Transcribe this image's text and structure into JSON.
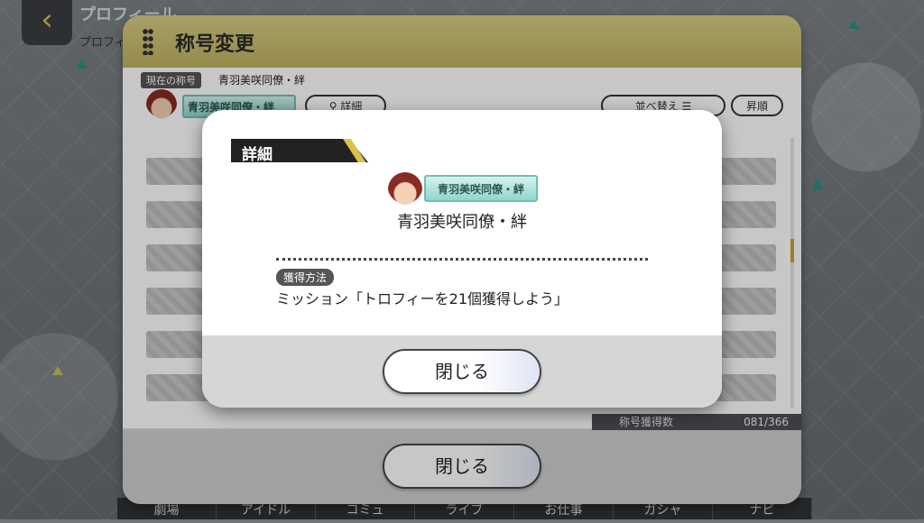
{
  "screen": {
    "title": "プロフィール",
    "subtitle": "プロフィ"
  },
  "bottom_nav": [
    "劇場",
    "アイドル",
    "コミュ",
    "ライブ",
    "お仕事",
    "ガシャ",
    "ナビ"
  ],
  "panel": {
    "title": "称号変更",
    "current_label": "現在の称号",
    "current_value": "青羽美咲同僚・絆",
    "plate_text": "青羽美咲同僚・絆",
    "detail_button": "詳細",
    "sort_button": "並べ替え",
    "order_button": "昇順",
    "count_label": "称号獲得数",
    "count_value": "081/366",
    "close_label": "閉じる"
  },
  "dialog": {
    "header": "詳細",
    "plate_text": "青羽美咲同僚・絆",
    "title_name": "青羽美咲同僚・絆",
    "method_label": "獲得方法",
    "method_value": "ミッション「トロフィーを21個獲得しよう」",
    "close_label": "閉じる"
  },
  "colors": {
    "header_gold": "#c9bc6d",
    "accent_gold": "#d7c24a",
    "plate_teal": "#8fd6cc"
  }
}
